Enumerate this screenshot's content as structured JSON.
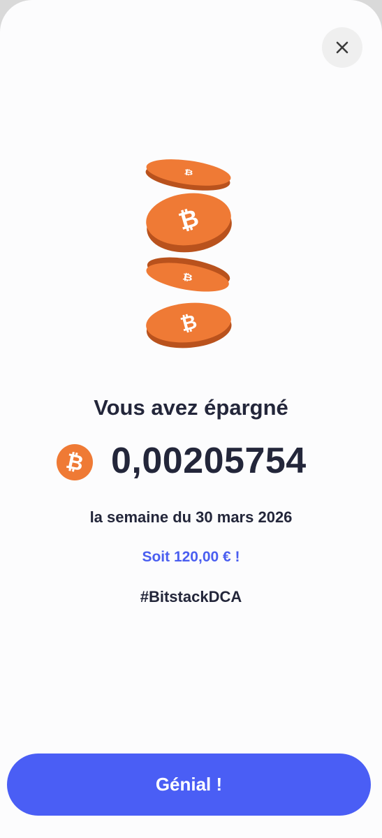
{
  "close_button": {
    "icon": "close-icon"
  },
  "illustration": {
    "icon": "bitcoin-coins-icon"
  },
  "colors": {
    "accent": "#4a5ef5",
    "fiat_text": "#4a5ef0",
    "bitcoin_orange": "#ef7a35",
    "text": "#23263a"
  },
  "summary": {
    "headline": "Vous avez épargné",
    "btc_icon": "bitcoin-icon",
    "amount": "0,00205754",
    "period": "la semaine du 30 mars 2026",
    "fiat_equivalent": "Soit 120,00 € !",
    "hashtag": "#BitstackDCA"
  },
  "cta": {
    "label": "Génial !"
  }
}
